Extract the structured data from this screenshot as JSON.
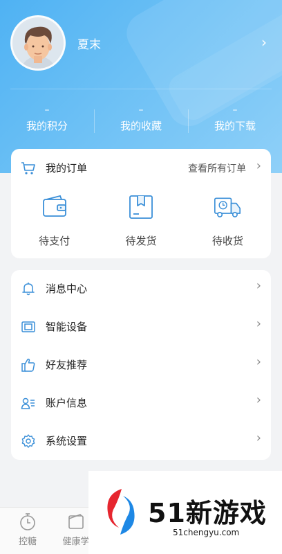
{
  "profile": {
    "username": "夏末",
    "arrow": "›"
  },
  "stats": [
    {
      "value": "–",
      "label": "我的积分"
    },
    {
      "value": "–",
      "label": "我的收藏"
    },
    {
      "value": "–",
      "label": "我的下载"
    }
  ],
  "orders": {
    "title": "我的订单",
    "view_all": "查看所有订单",
    "arrow": "›",
    "items": [
      {
        "label": "待支付",
        "icon": "wallet-icon"
      },
      {
        "label": "待发货",
        "icon": "package-icon"
      },
      {
        "label": "待收货",
        "icon": "delivery-truck-icon"
      }
    ]
  },
  "menu": {
    "arrow": "›",
    "items": [
      {
        "label": "消息中心",
        "icon": "bell-icon"
      },
      {
        "label": "智能设备",
        "icon": "device-icon"
      },
      {
        "label": "好友推荐",
        "icon": "thumbs-up-icon"
      },
      {
        "label": "账户信息",
        "icon": "account-card-icon"
      },
      {
        "label": "系统设置",
        "icon": "gear-icon"
      }
    ]
  },
  "tabbar": {
    "items": [
      {
        "label": "控糖",
        "icon": "stopwatch-icon"
      },
      {
        "label": "健康学",
        "icon": "book-icon"
      }
    ]
  },
  "watermark": {
    "title": "51新游戏",
    "subtitle": "51chengyu.com"
  },
  "colors": {
    "accent": "#4fb2f3",
    "icon_blue": "#3a8fd8",
    "background": "#f2f3f5"
  }
}
